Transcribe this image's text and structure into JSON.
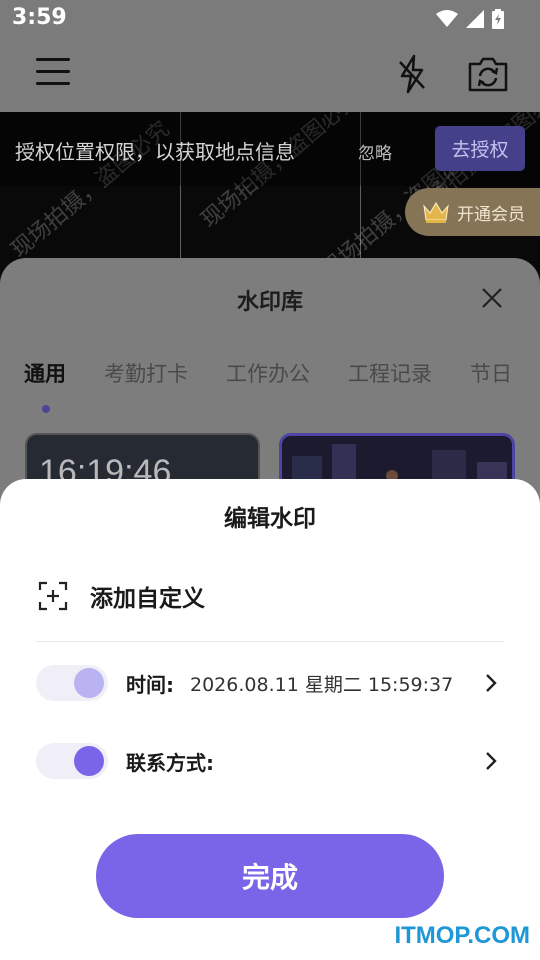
{
  "status_bar": {
    "time": "3:59"
  },
  "permission_bar": {
    "message": "授权位置权限，以获取地点信息",
    "ignore_label": "忽略",
    "authorize_label": "去授权"
  },
  "vip": {
    "label": "开通会员"
  },
  "preview_watermark_texts": [
    "现场拍摄，盗图必究",
    "现场拍摄，盗图必究",
    "现场拍摄，盗图必究",
    "现场拍摄，盗图必究"
  ],
  "library": {
    "title": "水印库",
    "tabs": [
      "通用",
      "考勤打卡",
      "工作办公",
      "工程记录",
      "节日"
    ],
    "active_tab": "通用",
    "thumb_time": "16:19:46"
  },
  "edit": {
    "title": "编辑水印",
    "add_custom_label": "添加自定义",
    "rows": [
      {
        "label": "时间:",
        "value": "2026.08.11 星期二 15:59:37"
      },
      {
        "label": "联系方式:",
        "value": ""
      }
    ],
    "done_label": "完成"
  },
  "site_watermark": "ITMOP.COM",
  "colors": {
    "accent": "#7a65e8",
    "toggle_light": "#b9b3f1",
    "toggle_track": "#f0eff7",
    "site_watermark": "#1d97d6"
  }
}
